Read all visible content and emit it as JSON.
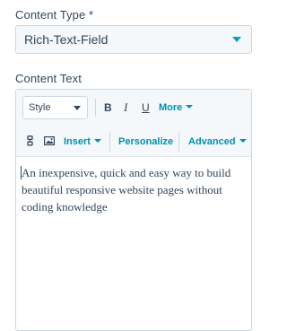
{
  "fields": {
    "content_type": {
      "label": "Content Type *",
      "value": "Rich-Text-Field"
    },
    "content_text": {
      "label": "Content Text"
    }
  },
  "toolbar": {
    "style_label": "Style",
    "bold_label": "B",
    "italic_label": "I",
    "underline_label": "U",
    "more_label": "More",
    "insert_label": "Insert",
    "personalize_label": "Personalize",
    "advanced_label": "Advanced",
    "icons": [
      "embed-icon",
      "image-icon"
    ]
  },
  "editor": {
    "text": "An inexpensive, quick and easy way to build beautiful responsive website pages without coding knowledge"
  },
  "colors": {
    "text": "#33475b",
    "accent": "#00a4bd",
    "link": "#0091ae",
    "border": "#cbd6e2",
    "field_bg": "#f5f8fa"
  }
}
